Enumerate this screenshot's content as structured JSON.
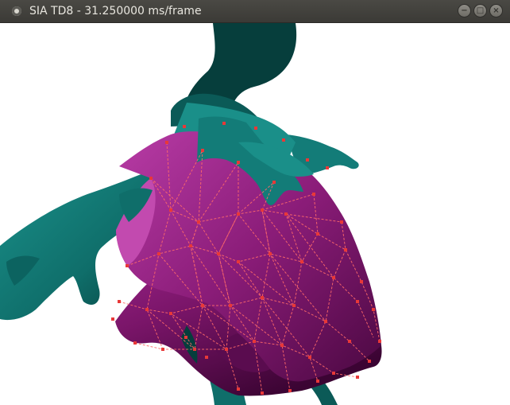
{
  "window": {
    "title": "SIA TD8 - 31.250000 ms/frame",
    "controls": {
      "minimize_icon": "minimize-icon",
      "maximize_icon": "maximize-icon",
      "close_icon": "close-icon"
    }
  },
  "scene": {
    "background": "#ffffff",
    "character_color": "#137c78",
    "character_shadow": "#063e3c",
    "cloth_color": "#8a1c78",
    "cloth_dark": "#3b0433",
    "mesh_color": "#ff6a6a",
    "vertex_color": "#e83838"
  }
}
